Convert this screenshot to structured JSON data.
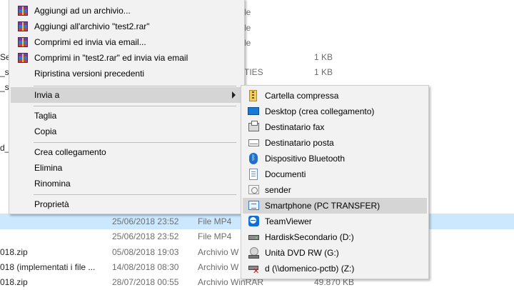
{
  "background": {
    "fragments": [
      "Se",
      "_se",
      "_se",
      "d_s",
      "le",
      "le",
      "le",
      "TIES",
      "1 KB",
      "1 KB"
    ],
    "rows": [
      {
        "name": "",
        "date": "25/06/2018 23:52",
        "type": "File MP4",
        "size": ""
      },
      {
        "name": "",
        "date": "25/06/2018 23:52",
        "type": "File MP4",
        "size": ""
      },
      {
        "name": "018.zip",
        "date": "05/08/2018 19:03",
        "type": "Archivio W",
        "size": ""
      },
      {
        "name": "018 (implementati i file ...",
        "date": "14/08/2018 08:30",
        "type": "Archivio W",
        "size": ""
      },
      {
        "name": "018.zip",
        "date": "28/07/2018 00:55",
        "type": "Archivio WinRAR",
        "size": "49.870 KB"
      }
    ]
  },
  "context_menu": {
    "items": [
      {
        "label": "Aggiungi ad un archivio...",
        "icon": "winrar-icon"
      },
      {
        "label": "Aggiungi all'archivio \"test2.rar\"",
        "icon": "winrar-icon"
      },
      {
        "label": "Comprimi ed invia via email...",
        "icon": "winrar-icon"
      },
      {
        "label": "Comprimi in \"test2.rar\" ed invia via email",
        "icon": "winrar-icon"
      },
      {
        "label": "Ripristina versioni precedenti",
        "icon": ""
      },
      {
        "label": "Invia a",
        "icon": "",
        "submenu": true
      },
      {
        "label": "Taglia",
        "icon": ""
      },
      {
        "label": "Copia",
        "icon": ""
      },
      {
        "label": "Crea collegamento",
        "icon": ""
      },
      {
        "label": "Elimina",
        "icon": ""
      },
      {
        "label": "Rinomina",
        "icon": ""
      },
      {
        "label": "Proprietà",
        "icon": ""
      }
    ]
  },
  "send_to_menu": {
    "items": [
      {
        "label": "Cartella compressa",
        "icon": "zip-folder-icon"
      },
      {
        "label": "Desktop (crea collegamento)",
        "icon": "desktop-icon"
      },
      {
        "label": "Destinatario fax",
        "icon": "fax-icon"
      },
      {
        "label": "Destinatario posta",
        "icon": "mail-icon"
      },
      {
        "label": "Dispositivo Bluetooth",
        "icon": "bluetooth-icon"
      },
      {
        "label": "Documenti",
        "icon": "documents-icon"
      },
      {
        "label": "sender",
        "icon": "sender-icon"
      },
      {
        "label": "Smartphone (PC TRANSFER)",
        "icon": "smartphone-icon"
      },
      {
        "label": "TeamViewer",
        "icon": "teamviewer-icon"
      },
      {
        "label": "HardiskSecondario (D:)",
        "icon": "hard-drive-icon"
      },
      {
        "label": "Unità DVD RW (G:)",
        "icon": "dvd-drive-icon"
      },
      {
        "label": "d (\\\\domenico-pctb) (Z:)",
        "icon": "network-drive-icon"
      }
    ]
  }
}
